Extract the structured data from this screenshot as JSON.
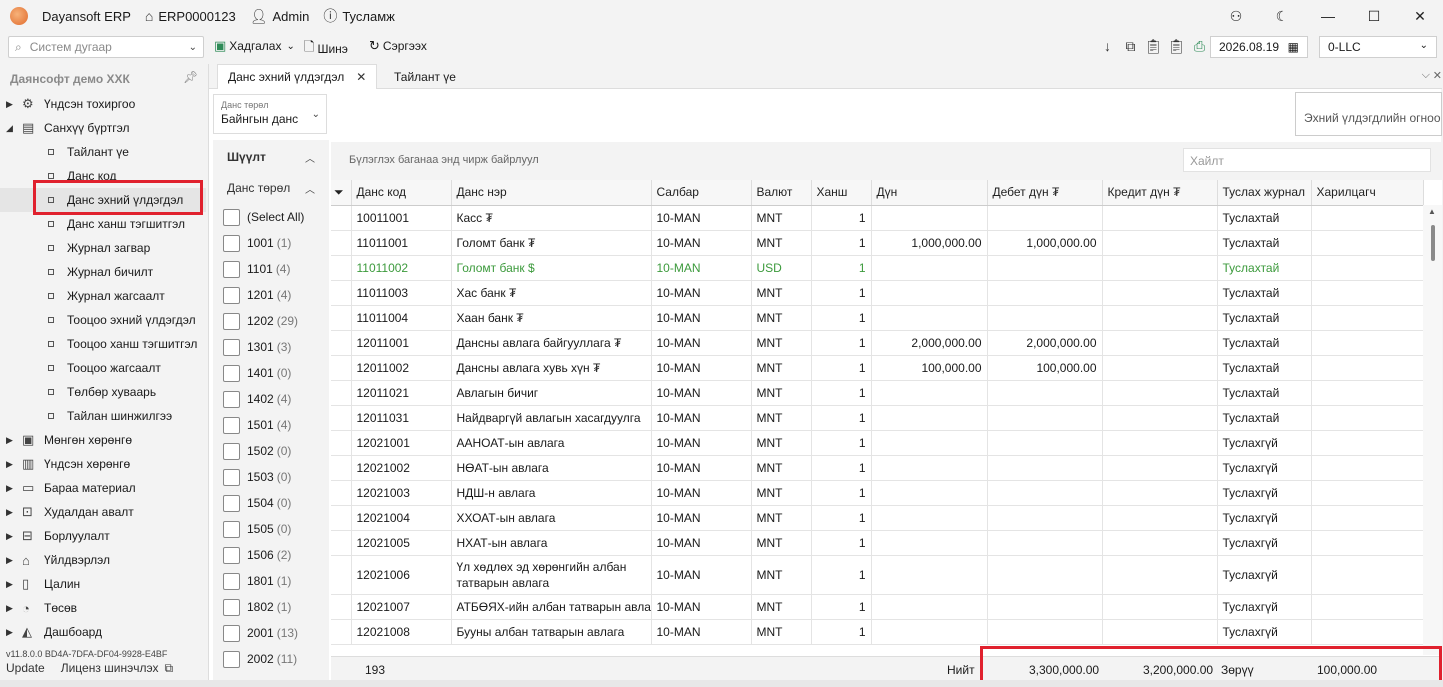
{
  "titlebar": {
    "app": "Dayansoft ERP",
    "code": "ERP0000123",
    "user": "Admin",
    "help": "Тусламж"
  },
  "toolbar": {
    "search_placeholder": "Систем дугаар",
    "save": "Хадгалах",
    "new": "Шинэ",
    "refresh": "Сэргээх",
    "date": "2026.08.19",
    "company": "0-LLC"
  },
  "sidebar": {
    "title": "Даянсофт демо ХХК",
    "groups": [
      {
        "label": "Үндсэн тохиргоо"
      },
      {
        "label": "Санхүү бүртгэл"
      }
    ],
    "children": [
      "Тайлант үе",
      "Данс код",
      "Данс эхний үлдэгдэл",
      "Данс ханш тэгшитгэл",
      "Журнал загвар",
      "Журнал бичилт",
      "Журнал жагсаалт",
      "Тооцоо эхний үлдэгдэл",
      "Тооцоо ханш тэгшитгэл",
      "Тооцоо жагсаалт",
      "Төлбөр хуваарь",
      "Тайлан шинжилгээ"
    ],
    "modules": [
      "Мөнгөн хөрөнгө",
      "Үндсэн хөрөнгө",
      "Бараа материал",
      "Худалдан авалт",
      "Борлуулалт",
      "Үйлдвэрлэл",
      "Цалин",
      "Төсөв",
      "Дашбоард"
    ],
    "version": "v11.8.0.0   BD4A-7DFA-DF04-9928-E4BF",
    "update": "Update",
    "license": "Лиценз шинэчлэх"
  },
  "tabs": [
    {
      "label": "Данс эхний үлдэгдэл"
    },
    {
      "label": "Тайлант үе"
    }
  ],
  "filter": {
    "caption": "Данс төрөл",
    "value": "Байнгын данс",
    "opening": "Эхний үлдэгдлийн огноо",
    "header": "Шүүлт",
    "subheader": "Данс төрөл",
    "options": [
      {
        "label": "(Select All)",
        "count": ""
      },
      {
        "label": "1001",
        "count": "(1)"
      },
      {
        "label": "1101",
        "count": "(4)"
      },
      {
        "label": "1201",
        "count": "(4)"
      },
      {
        "label": "1202",
        "count": "(29)"
      },
      {
        "label": "1301",
        "count": "(3)"
      },
      {
        "label": "1401",
        "count": "(0)"
      },
      {
        "label": "1402",
        "count": "(4)"
      },
      {
        "label": "1501",
        "count": "(4)"
      },
      {
        "label": "1502",
        "count": "(0)"
      },
      {
        "label": "1503",
        "count": "(0)"
      },
      {
        "label": "1504",
        "count": "(0)"
      },
      {
        "label": "1505",
        "count": "(0)"
      },
      {
        "label": "1506",
        "count": "(2)"
      },
      {
        "label": "1801",
        "count": "(1)"
      },
      {
        "label": "1802",
        "count": "(1)"
      },
      {
        "label": "2001",
        "count": "(13)"
      },
      {
        "label": "2002",
        "count": "(11)"
      }
    ]
  },
  "grid": {
    "group_hint": "Бүлэглэх баганаа энд чирж байрлуул",
    "search_placeholder": "Хайлт",
    "columns": [
      "Данс код",
      "Данс нэр",
      "Салбар",
      "Валют",
      "Ханш",
      "Дүн",
      "Дебет дүн ₮",
      "Кредит дүн ₮",
      "Туслах журнал",
      "Харилцагч"
    ],
    "rows": [
      {
        "code": "10011001",
        "name": "Касс ₮",
        "branch": "10-MAN",
        "cur": "MNT",
        "rate": "1",
        "amount": "",
        "debit": "",
        "credit": "",
        "journal": "Туслахтай",
        "party": ""
      },
      {
        "code": "11011001",
        "name": "Голомт банк ₮",
        "branch": "10-MAN",
        "cur": "MNT",
        "rate": "1",
        "amount": "1,000,000.00",
        "debit": "1,000,000.00",
        "credit": "",
        "journal": "Туслахтай",
        "party": ""
      },
      {
        "code": "11011002",
        "name": "Голомт банк $",
        "branch": "10-MAN",
        "cur": "USD",
        "rate": "1",
        "amount": "",
        "debit": "",
        "credit": "",
        "journal": "Туслахтай",
        "party": ""
      },
      {
        "code": "11011003",
        "name": "Хас банк ₮",
        "branch": "10-MAN",
        "cur": "MNT",
        "rate": "1",
        "amount": "",
        "debit": "",
        "credit": "",
        "journal": "Туслахтай",
        "party": ""
      },
      {
        "code": "11011004",
        "name": "Хаан банк ₮",
        "branch": "10-MAN",
        "cur": "MNT",
        "rate": "1",
        "amount": "",
        "debit": "",
        "credit": "",
        "journal": "Туслахтай",
        "party": ""
      },
      {
        "code": "12011001",
        "name": "Дансны авлага байгууллага ₮",
        "branch": "10-MAN",
        "cur": "MNT",
        "rate": "1",
        "amount": "2,000,000.00",
        "debit": "2,000,000.00",
        "credit": "",
        "journal": "Туслахтай",
        "party": ""
      },
      {
        "code": "12011002",
        "name": "Дансны авлага хувь хүн ₮",
        "branch": "10-MAN",
        "cur": "MNT",
        "rate": "1",
        "amount": "100,000.00",
        "debit": "100,000.00",
        "credit": "",
        "journal": "Туслахтай",
        "party": ""
      },
      {
        "code": "12011021",
        "name": "Авлагын бичиг",
        "branch": "10-MAN",
        "cur": "MNT",
        "rate": "1",
        "amount": "",
        "debit": "",
        "credit": "",
        "journal": "Туслахтай",
        "party": ""
      },
      {
        "code": "12011031",
        "name": "Найдваргүй авлагын хасагдуулга",
        "branch": "10-MAN",
        "cur": "MNT",
        "rate": "1",
        "amount": "",
        "debit": "",
        "credit": "",
        "journal": "Туслахтай",
        "party": ""
      },
      {
        "code": "12021001",
        "name": "ААНОАТ-ын авлага",
        "branch": "10-MAN",
        "cur": "MNT",
        "rate": "1",
        "amount": "",
        "debit": "",
        "credit": "",
        "journal": "Туслахгүй",
        "party": ""
      },
      {
        "code": "12021002",
        "name": "НӨАТ-ын авлага",
        "branch": "10-MAN",
        "cur": "MNT",
        "rate": "1",
        "amount": "",
        "debit": "",
        "credit": "",
        "journal": "Туслахгүй",
        "party": ""
      },
      {
        "code": "12021003",
        "name": "НДШ-н авлага",
        "branch": "10-MAN",
        "cur": "MNT",
        "rate": "1",
        "amount": "",
        "debit": "",
        "credit": "",
        "journal": "Туслахгүй",
        "party": ""
      },
      {
        "code": "12021004",
        "name": "ХХОАТ-ын авлага",
        "branch": "10-MAN",
        "cur": "MNT",
        "rate": "1",
        "amount": "",
        "debit": "",
        "credit": "",
        "journal": "Туслахгүй",
        "party": ""
      },
      {
        "code": "12021005",
        "name": "НХАТ-ын авлага",
        "branch": "10-MAN",
        "cur": "MNT",
        "rate": "1",
        "amount": "",
        "debit": "",
        "credit": "",
        "journal": "Туслахгүй",
        "party": ""
      },
      {
        "code": "12021006",
        "name": "Үл хөдлөх эд хөрөнгийн албан татварын авлага",
        "branch": "10-MAN",
        "cur": "MNT",
        "rate": "1",
        "amount": "",
        "debit": "",
        "credit": "",
        "journal": "Туслахгүй",
        "party": ""
      },
      {
        "code": "12021007",
        "name": "АТБӨЯХ-ийн албан татварын авлага",
        "branch": "10-MAN",
        "cur": "MNT",
        "rate": "1",
        "amount": "",
        "debit": "",
        "credit": "",
        "journal": "Туслахгүй",
        "party": ""
      },
      {
        "code": "12021008",
        "name": "Бууны албан татварын авлага",
        "branch": "10-MAN",
        "cur": "MNT",
        "rate": "1",
        "amount": "",
        "debit": "",
        "credit": "",
        "journal": "Туслахгүй",
        "party": ""
      }
    ],
    "footer": {
      "count": "193",
      "total_label": "Нийт",
      "debit": "3,300,000.00",
      "credit": "3,200,000.00",
      "diff": "Зөрүү",
      "diff_value": "100,000.00"
    }
  }
}
